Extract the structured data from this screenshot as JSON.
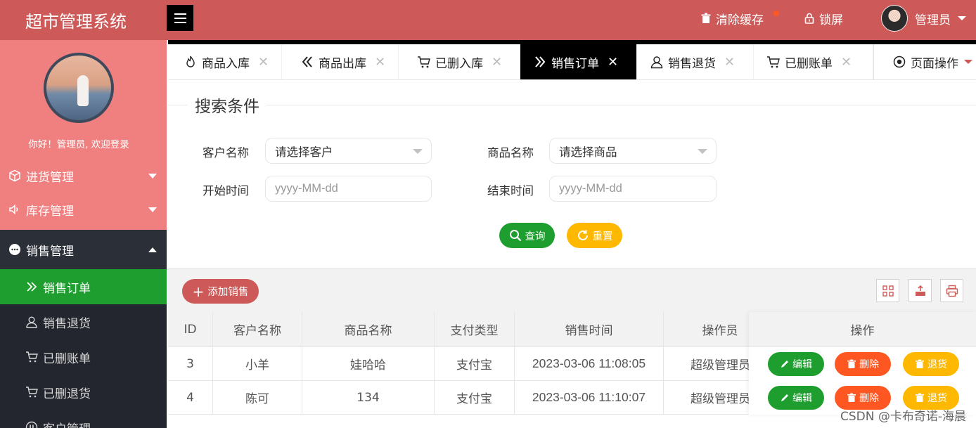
{
  "header": {
    "logo": "超市管理系统",
    "clear_cache": "清除缓存",
    "lock": "锁屏",
    "user": "管理员"
  },
  "sidebar": {
    "welcome": "你好！管理员, 欢迎登录",
    "menus": [
      {
        "label": "进货管理",
        "icon": "cube-icon"
      },
      {
        "label": "库存管理",
        "icon": "speaker-icon"
      },
      {
        "label": "销售管理",
        "icon": "chat-icon"
      }
    ],
    "submenu": [
      {
        "label": "销售订单",
        "icon": "double-chevron-right-icon",
        "active": true
      },
      {
        "label": "销售退货",
        "icon": "user-icon"
      },
      {
        "label": "已删账单",
        "icon": "cart-icon"
      },
      {
        "label": "已删退货",
        "icon": "cart-icon"
      },
      {
        "label": "客户管理",
        "icon": "pause-circle-icon"
      }
    ]
  },
  "tabs": [
    {
      "label": "商品入库",
      "icon": "fire-icon"
    },
    {
      "label": "商品出库",
      "icon": "double-chevron-left-icon"
    },
    {
      "label": "已删入库",
      "icon": "cart-icon"
    },
    {
      "label": "销售订单",
      "icon": "double-chevron-right-icon",
      "active": true
    },
    {
      "label": "销售退货",
      "icon": "user-icon"
    },
    {
      "label": "已删账单",
      "icon": "cart-icon"
    }
  ],
  "page_ops": "页面操作",
  "search": {
    "legend": "搜索条件",
    "customer_label": "客户名称",
    "customer_placeholder": "请选择客户",
    "product_label": "商品名称",
    "product_placeholder": "请选择商品",
    "start_label": "开始时间",
    "start_placeholder": "yyyy-MM-dd",
    "end_label": "结束时间",
    "end_placeholder": "yyyy-MM-dd",
    "query_btn": "查询",
    "reset_btn": "重置"
  },
  "toolbar": {
    "add_btn": "添加销售"
  },
  "table": {
    "columns": [
      "ID",
      "客户名称",
      "商品名称",
      "支付类型",
      "销售时间",
      "操作员",
      "操作"
    ],
    "rows": [
      {
        "id": "3",
        "customer": "小羊",
        "product": "娃哈哈",
        "pay": "支付宝",
        "time": "2023-03-06 11:08:05",
        "operator": "超级管理员"
      },
      {
        "id": "4",
        "customer": "陈可",
        "product": "134",
        "pay": "支付宝",
        "time": "2023-03-06 11:10:07",
        "operator": "超级管理员"
      }
    ],
    "actions": {
      "edit": "编辑",
      "delete": "删除",
      "return": "退货"
    }
  },
  "watermark": "CSDN @卡布奇诺-海晨",
  "colors": {
    "brand": "#cd5a58",
    "sidebar": "#f08080",
    "active_green": "#1e9e2f",
    "orange": "#ff5722",
    "yellow": "#ffb800",
    "dark": "#23262e"
  }
}
